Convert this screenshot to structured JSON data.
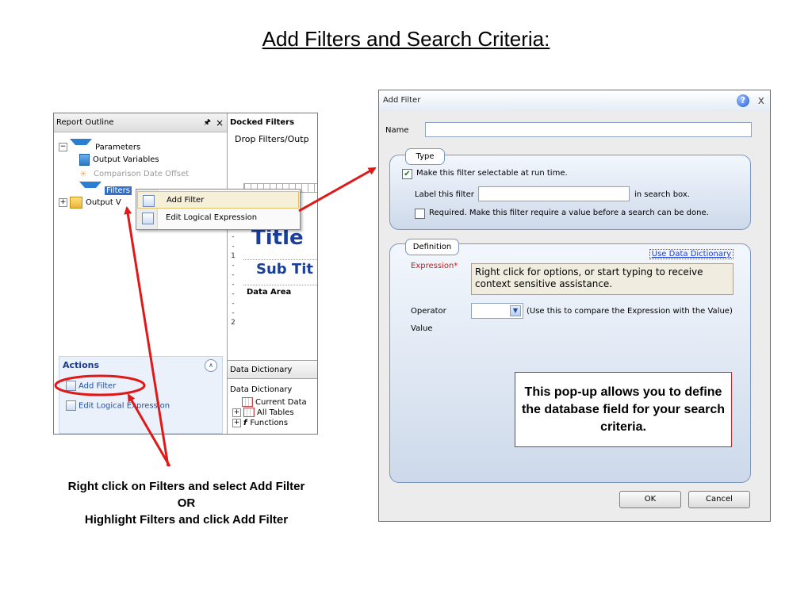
{
  "slide": {
    "title": "Add Filters and Search Criteria:",
    "caption_line1": "Right click on Filters and select Add Filter",
    "caption_line2": "OR",
    "caption_line3": "Highlight Filters and click Add Filter"
  },
  "report_outline": {
    "header": "Report Outline",
    "pin": "ᵖ",
    "close": "×",
    "tree": {
      "parameters": "Parameters",
      "output_variables": "Output Variables",
      "comparison_date_offset": "Comparison Date Offset",
      "filters": "Filters",
      "output_partial": "Output V"
    }
  },
  "actions": {
    "header": "Actions",
    "add_filter": "Add Filter",
    "edit_logical_expression": "Edit Logical Expression"
  },
  "designer": {
    "docked_filters": "Docked Filters",
    "drop_text": "Drop Filters/Outp",
    "title": "Title",
    "sub_title": "Sub Tit",
    "data_area": "Data Area",
    "ruler_marks": [
      "-",
      "-",
      "-",
      "1",
      "-",
      "-",
      "-",
      "-",
      "-",
      "-",
      "2"
    ]
  },
  "data_dictionary": {
    "tab": "Data Dictionary",
    "header": "Data Dictionary",
    "items": [
      "Current Data",
      "All Tables",
      "Functions"
    ]
  },
  "context_menu": {
    "add_filter": "Add Filter",
    "edit_logical_expression": "Edit Logical Expression"
  },
  "dialog": {
    "title": "Add Filter",
    "help": "?",
    "close": "x",
    "name_label": "Name",
    "name_value": "",
    "type_group": {
      "tab": "Type",
      "selectable_label": "Make this filter selectable at run time.",
      "selectable_checked": true,
      "label_filter_label": "Label this filter",
      "label_filter_value": "",
      "search_box_suffix": "in search box.",
      "required_label": "Required. Make this filter require a value before a search can be done.",
      "required_checked": false
    },
    "definition_group": {
      "tab": "Definition",
      "use_data_dictionary": "Use Data Dictionary",
      "expression_label": "Expression*",
      "expression_hint": "Right click for options, or start typing to receive context sensitive assistance.",
      "operator_label": "Operator",
      "operator_hint": "(Use this to compare the Expression with the Value)",
      "value_label": "Value"
    },
    "callout": "This pop-up allows you to define the database field for your search criteria.",
    "ok": "OK",
    "cancel": "Cancel"
  },
  "colors": {
    "annotation_red": "#e01818",
    "selection_blue": "#3572c7",
    "title_blue": "#1a3e9c"
  }
}
